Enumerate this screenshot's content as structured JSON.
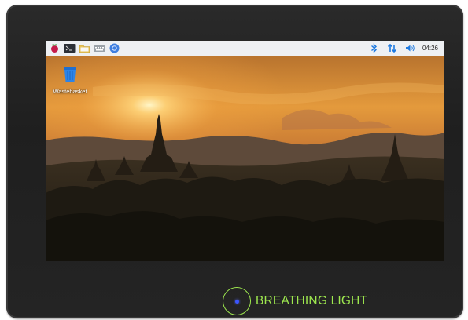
{
  "taskbar": {
    "left_icons": [
      "raspberry-menu-icon",
      "terminal-icon",
      "file-manager-icon",
      "keyboard-icon",
      "chromium-browser-icon"
    ],
    "right_icons": [
      "bluetooth-icon",
      "network-icon",
      "volume-icon"
    ],
    "clock": "04:26"
  },
  "desktop": {
    "icons": [
      {
        "label": "Wastebasket",
        "icon": "wastebasket-icon"
      }
    ],
    "wallpaper": "sunset-temples-landscape"
  },
  "device": {
    "breathing_light_label": "BREATHING LIGHT"
  },
  "colors": {
    "taskbar_bg": "#eef0f3",
    "accent_green": "#9ee84f",
    "led_blue": "#3b55ff",
    "bluetooth_blue": "#1f7ae0",
    "bezel": "#222222"
  }
}
